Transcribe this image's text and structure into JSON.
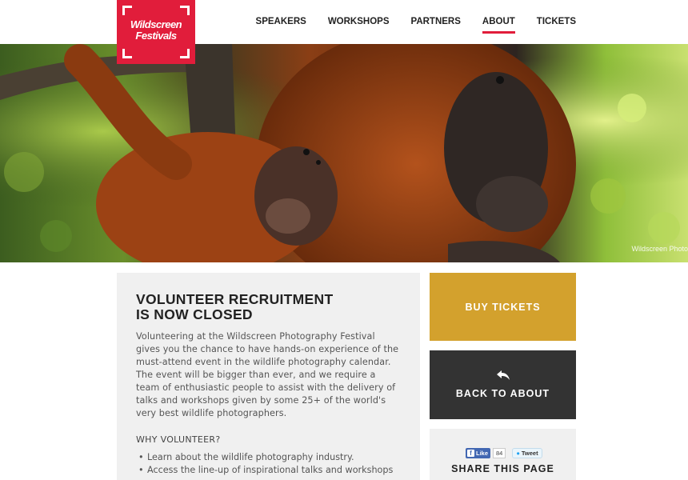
{
  "brand": {
    "logo_line1": "Wildscreen",
    "logo_line2": "Festivals",
    "accent_color": "#e11d3b"
  },
  "nav": {
    "items": [
      {
        "label": "SPEAKERS",
        "active": false
      },
      {
        "label": "WORKSHOPS",
        "active": false
      },
      {
        "label": "PARTNERS",
        "active": false
      },
      {
        "label": "ABOUT",
        "active": true
      },
      {
        "label": "TICKETS",
        "active": false
      }
    ]
  },
  "hero": {
    "credit": "Wildscreen Photo"
  },
  "content": {
    "title_line1": "VOLUNTEER RECRUITMENT",
    "title_line2": "IS NOW CLOSED",
    "intro": "Volunteering at the Wildscreen Photography Festival gives you the chance to have hands-on experience of the must-attend event in the wildlife photography calendar. The event will be bigger than ever, and we require a team of enthusiastic people to assist with the delivery of talks and workshops given by some 25+ of the world's very best wildlife photographers.",
    "why_heading": "WHY VOLUNTEER?",
    "reasons": [
      "Learn about the wildlife photography industry.",
      "Access the line-up of inspirational talks and workshops"
    ]
  },
  "sidebar": {
    "buy_tickets": "BUY TICKETS",
    "buy_color": "#d3a12d",
    "back_label": "BACK TO ABOUT",
    "back_color": "#333333",
    "share": {
      "like_label": "Like",
      "like_count": "84",
      "tweet_label": "Tweet",
      "title": "SHARE THIS PAGE"
    }
  }
}
